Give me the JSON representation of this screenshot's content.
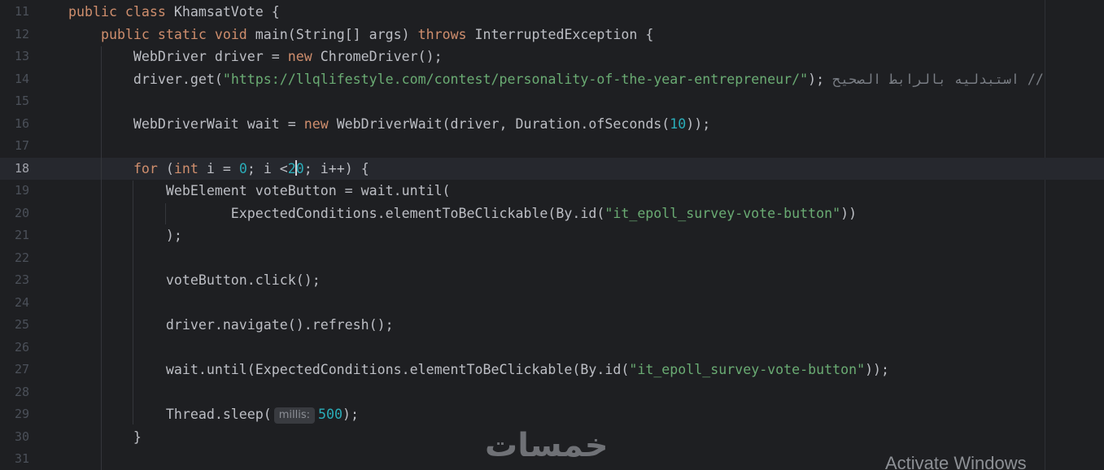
{
  "editor": {
    "current_line": "18",
    "lines": [
      {
        "number": "11",
        "segments": [
          {
            "t": "kw",
            "v": "public class "
          },
          {
            "t": "p",
            "v": "KhamsatVote {"
          }
        ]
      },
      {
        "number": "12",
        "segments": [
          {
            "t": "p",
            "v": "    "
          },
          {
            "t": "kw",
            "v": "public static void "
          },
          {
            "t": "p",
            "v": "main(String[] args) "
          },
          {
            "t": "kw",
            "v": "throws "
          },
          {
            "t": "p",
            "v": "InterruptedException {"
          }
        ]
      },
      {
        "number": "13",
        "segments": [
          {
            "t": "p",
            "v": "        WebDriver driver = "
          },
          {
            "t": "kw",
            "v": "new "
          },
          {
            "t": "p",
            "v": "ChromeDriver();"
          }
        ]
      },
      {
        "number": "14",
        "segments": [
          {
            "t": "p",
            "v": "        driver.get("
          },
          {
            "t": "str",
            "v": "\"https://llqlifestyle.com/contest/personality-of-the-year-entrepreneur/\""
          },
          {
            "t": "p",
            "v": "); "
          },
          {
            "t": "cmt",
            "v": "// استبدليه بالرابط الصحيح"
          }
        ]
      },
      {
        "number": "15",
        "segments": []
      },
      {
        "number": "16",
        "segments": [
          {
            "t": "p",
            "v": "        WebDriverWait wait = "
          },
          {
            "t": "kw",
            "v": "new "
          },
          {
            "t": "p",
            "v": "WebDriverWait(driver, Duration.ofSeconds("
          },
          {
            "t": "num",
            "v": "10"
          },
          {
            "t": "p",
            "v": "));"
          }
        ]
      },
      {
        "number": "17",
        "segments": []
      },
      {
        "number": "18",
        "segments": [
          {
            "t": "p",
            "v": "        "
          },
          {
            "t": "kw",
            "v": "for "
          },
          {
            "t": "p",
            "v": "("
          },
          {
            "t": "kw",
            "v": "int "
          },
          {
            "t": "p",
            "v": "i = "
          },
          {
            "t": "num",
            "v": "0"
          },
          {
            "t": "p",
            "v": "; i <"
          },
          {
            "t": "num",
            "v": "2"
          },
          {
            "t": "caret",
            "v": ""
          },
          {
            "t": "num",
            "v": "0"
          },
          {
            "t": "p",
            "v": "; i++) {"
          }
        ]
      },
      {
        "number": "19",
        "segments": [
          {
            "t": "p",
            "v": "            WebElement voteButton = wait.until("
          }
        ]
      },
      {
        "number": "20",
        "segments": [
          {
            "t": "p",
            "v": "                    ExpectedConditions.elementToBeClickable(By.id("
          },
          {
            "t": "str",
            "v": "\"it_epoll_survey-vote-button\""
          },
          {
            "t": "p",
            "v": "))"
          }
        ]
      },
      {
        "number": "21",
        "segments": [
          {
            "t": "p",
            "v": "            );"
          }
        ]
      },
      {
        "number": "22",
        "segments": []
      },
      {
        "number": "23",
        "segments": [
          {
            "t": "p",
            "v": "            voteButton.click();"
          }
        ]
      },
      {
        "number": "24",
        "segments": []
      },
      {
        "number": "25",
        "segments": [
          {
            "t": "p",
            "v": "            driver.navigate().refresh();"
          }
        ]
      },
      {
        "number": "26",
        "segments": []
      },
      {
        "number": "27",
        "segments": [
          {
            "t": "p",
            "v": "            wait.until(ExpectedConditions.elementToBeClickable(By.id("
          },
          {
            "t": "str",
            "v": "\"it_epoll_survey-vote-button\""
          },
          {
            "t": "p",
            "v": "));"
          }
        ]
      },
      {
        "number": "28",
        "segments": []
      },
      {
        "number": "29",
        "segments": [
          {
            "t": "p",
            "v": "            Thread.sleep("
          },
          {
            "t": "hint",
            "v": "millis:"
          },
          {
            "t": "num",
            "v": "500"
          },
          {
            "t": "p",
            "v": ");"
          }
        ]
      },
      {
        "number": "30",
        "segments": [
          {
            "t": "p",
            "v": "        }"
          }
        ]
      },
      {
        "number": "31",
        "segments": []
      }
    ]
  },
  "watermark": {
    "logo_text": "خمسات",
    "activate_text": "Activate Windows"
  },
  "colors": {
    "background": "#1e1f22",
    "keyword": "#cf8e6d",
    "string": "#6aab73",
    "number": "#2aacb8",
    "comment": "#7a7e85",
    "plain": "#bcbec4"
  }
}
